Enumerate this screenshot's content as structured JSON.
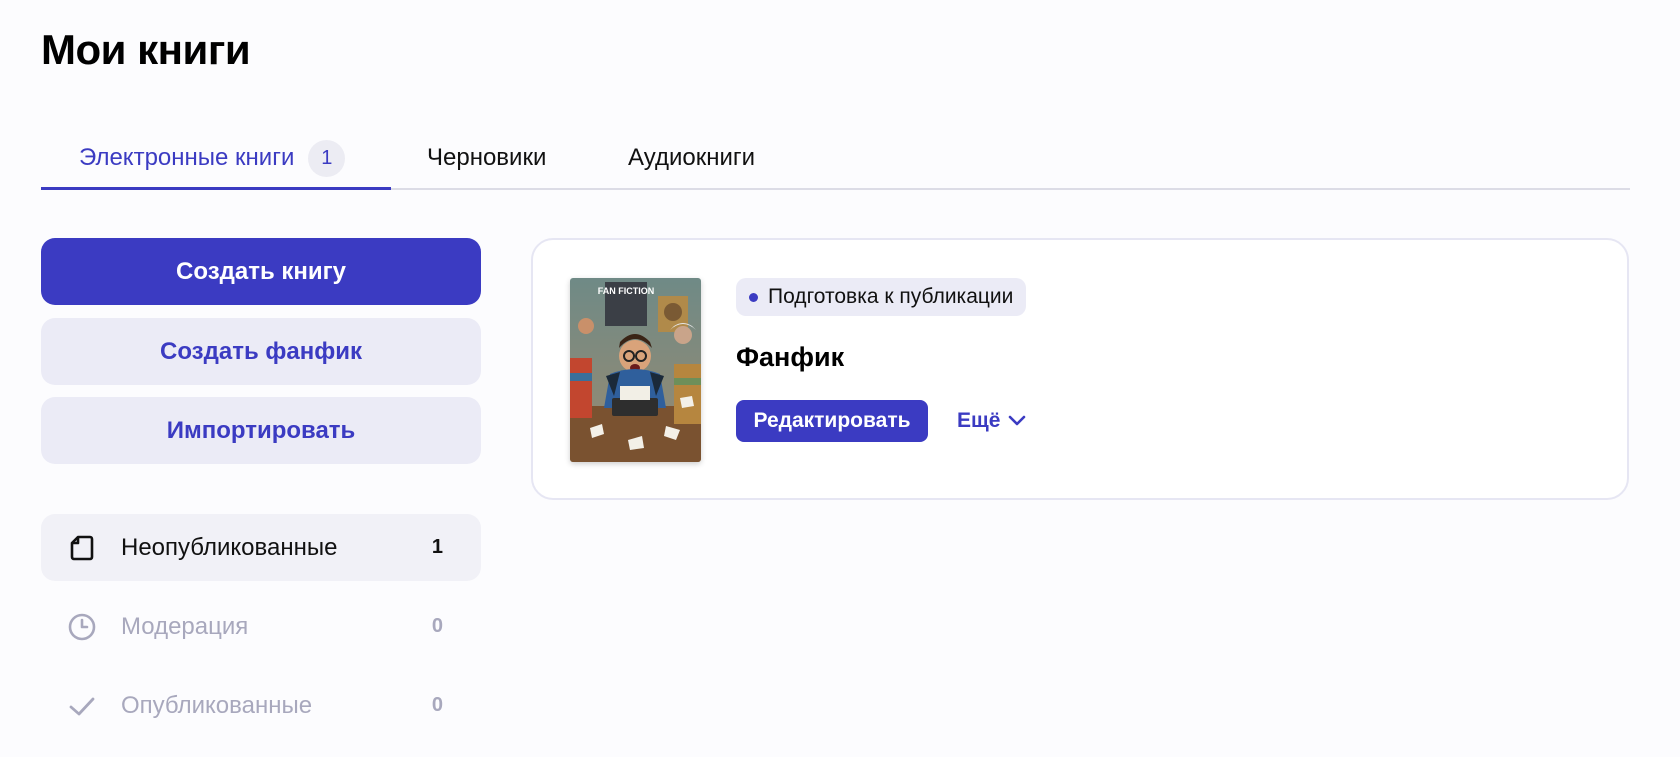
{
  "page": {
    "title": "Мои книги"
  },
  "tabs": [
    {
      "label": "Электронные книги",
      "badge": "1",
      "active": true
    },
    {
      "label": "Черновики"
    },
    {
      "label": "Аудиокниги"
    }
  ],
  "actions": {
    "create_book": "Создать книгу",
    "create_fanfic": "Создать фанфик",
    "import": "Импортировать"
  },
  "filters": [
    {
      "label": "Неопубликованные",
      "count": "1",
      "icon": "document-icon",
      "active": true
    },
    {
      "label": "Модерация",
      "count": "0",
      "icon": "clock-icon"
    },
    {
      "label": "Опубликованные",
      "count": "0",
      "icon": "check-icon"
    }
  ],
  "book": {
    "cover_text": "FAN FICTION",
    "status": "Подготовка к публикации",
    "title": "Фанфик",
    "edit_label": "Редактировать",
    "more_label": "Ещё"
  },
  "colors": {
    "accent": "#3b3bc2",
    "accent_soft": "#ebebf6",
    "muted": "#a8a8bd"
  }
}
